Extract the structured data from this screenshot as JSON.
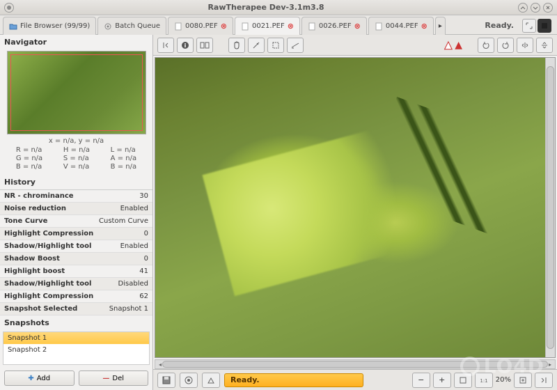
{
  "window": {
    "title": "RawTherapee Dev-3.1m3.8"
  },
  "tabs": {
    "file_browser": "File Browser  (99/99)",
    "batch_queue": "Batch Queue",
    "files": [
      "0080.PEF",
      "0021.PEF",
      "0026.PEF",
      "0044.PEF"
    ],
    "active_index": 1,
    "ready": "Ready."
  },
  "navigator": {
    "title": "Navigator",
    "coords": "x = n/a, y = n/a",
    "channels": {
      "col1": [
        "R = n/a",
        "G = n/a",
        "B = n/a"
      ],
      "col2": [
        "H = n/a",
        "S = n/a",
        "V = n/a"
      ],
      "col3": [
        "L = n/a",
        "A = n/a",
        "B = n/a"
      ]
    }
  },
  "history": {
    "title": "History",
    "rows": [
      {
        "label": "NR - chrominance",
        "value": "30"
      },
      {
        "label": "Noise reduction",
        "value": "Enabled"
      },
      {
        "label": "Tone Curve",
        "value": "Custom Curve"
      },
      {
        "label": "Highlight Compression",
        "value": "0"
      },
      {
        "label": "Shadow/Highlight tool",
        "value": "Enabled"
      },
      {
        "label": "Shadow Boost",
        "value": "0"
      },
      {
        "label": "Highlight boost",
        "value": "41"
      },
      {
        "label": "Shadow/Highlight tool",
        "value": "Disabled"
      },
      {
        "label": "Highlight Compression",
        "value": "62"
      },
      {
        "label": "Snapshot Selected",
        "value": "Snapshot 1"
      }
    ]
  },
  "snapshots": {
    "title": "Snapshots",
    "items": [
      "Snapshot 1",
      "Snapshot 2"
    ],
    "selected_index": 0,
    "add_label": "Add",
    "del_label": "Del"
  },
  "bottom": {
    "ready": "Ready.",
    "zoom": "20%"
  },
  "watermark": "LO4D"
}
